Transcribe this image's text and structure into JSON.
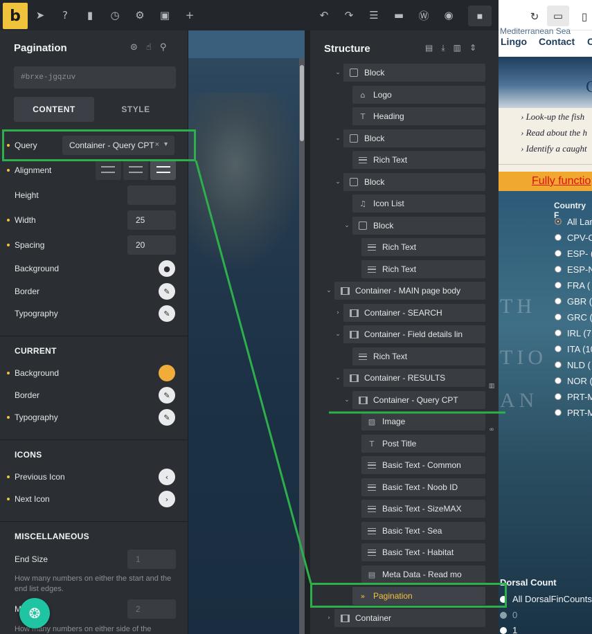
{
  "toolbar": {
    "logo": "b",
    "icons": [
      "pointer-icon",
      "help-icon",
      "pages-icon",
      "history-icon",
      "settings-icon",
      "template-icon",
      "add-icon"
    ],
    "right_icons": [
      "undo-icon",
      "redo-icon",
      "layout-icon",
      "folder-icon",
      "wordpress-icon",
      "preview-icon",
      "save-icon"
    ]
  },
  "preview_toolbar": {
    "icons": [
      "refresh-icon",
      "desktop-icon",
      "phone-icon"
    ]
  },
  "panel": {
    "title": "Pagination",
    "element_id": "#brxe-jgqzuv",
    "tabs": {
      "content": "CONTENT",
      "style": "STYLE"
    },
    "fields": {
      "query_label": "Query",
      "query_value": "Container - Query CPT",
      "alignment_label": "Alignment",
      "height_label": "Height",
      "height_value": "",
      "width_label": "Width",
      "width_value": "25",
      "spacing_label": "Spacing",
      "spacing_value": "20",
      "background_label": "Background",
      "border_label": "Border",
      "typography_label": "Typography"
    },
    "current": {
      "title": "CURRENT",
      "background_label": "Background",
      "background_color": "#f0ad3a",
      "border_label": "Border",
      "typography_label": "Typography"
    },
    "icons_section": {
      "title": "ICONS",
      "previous_label": "Previous Icon",
      "next_label": "Next Icon"
    },
    "misc": {
      "title": "MISCELLANEOUS",
      "end_size_label": "End Size",
      "end_size_placeholder": "1",
      "end_size_hint": "How many numbers on either the start and the end list edges.",
      "mid_size_label": "M",
      "mid_size_placeholder": "2",
      "mid_size_hint": "How many numbers on either side of the"
    }
  },
  "structure": {
    "title": "Structure",
    "nodes": [
      {
        "label": "Block",
        "icon": "box"
      },
      {
        "label": "Logo",
        "icon": "home"
      },
      {
        "label": "Heading",
        "icon": "T"
      },
      {
        "label": "Block",
        "icon": "box"
      },
      {
        "label": "Rich Text",
        "icon": "lines"
      },
      {
        "label": "Block",
        "icon": "box"
      },
      {
        "label": "Icon List",
        "icon": "bird"
      },
      {
        "label": "Block",
        "icon": "box"
      },
      {
        "label": "Rich Text",
        "icon": "lines"
      },
      {
        "label": "Rich Text",
        "icon": "lines"
      },
      {
        "label": "Container - MAIN page body",
        "icon": "film"
      },
      {
        "label": "Container - SEARCH",
        "icon": "film"
      },
      {
        "label": "Container - Field details lin",
        "icon": "film"
      },
      {
        "label": "Rich Text",
        "icon": "lines"
      },
      {
        "label": "Container - RESULTS",
        "icon": "film"
      },
      {
        "label": "Container - Query CPT",
        "icon": "film"
      },
      {
        "label": "Image",
        "icon": "image"
      },
      {
        "label": "Post Title",
        "icon": "T"
      },
      {
        "label": "Basic Text - Common",
        "icon": "lines"
      },
      {
        "label": "Basic Text - Noob ID",
        "icon": "lines"
      },
      {
        "label": "Basic Text - SizeMAX",
        "icon": "lines"
      },
      {
        "label": "Basic Text - Sea",
        "icon": "lines"
      },
      {
        "label": "Basic Text - Habitat",
        "icon": "lines"
      },
      {
        "label": "Meta Data - Read mo",
        "icon": "doc"
      },
      {
        "label": "Pagination",
        "icon": "chevrons"
      },
      {
        "label": "Container",
        "icon": "film"
      }
    ]
  },
  "preview": {
    "top_line": "Mediterranean Sea",
    "nav": [
      "Lingo",
      "Contact",
      "C"
    ],
    "hero_letter": "C",
    "bullets": [
      "› Look-up the fish",
      "› Read about the h",
      "› Identify a caught"
    ],
    "banner": "Fully functio",
    "country_label": "Country F",
    "countries": [
      "All Lar",
      "CPV-C",
      "ESP- (",
      "ESP-N",
      "FRA (",
      "GBR (",
      "GRC (",
      "IRL (7",
      "ITA (10",
      "NLD (",
      "NOR (",
      "PRT-M",
      "PRT-M"
    ],
    "dorsal_label": "Dorsal Count",
    "dorsal_options": [
      "All DorsalFinCounts",
      "0",
      "1"
    ]
  },
  "accent_color": "#f0c33c",
  "highlight_color": "#2db04b"
}
